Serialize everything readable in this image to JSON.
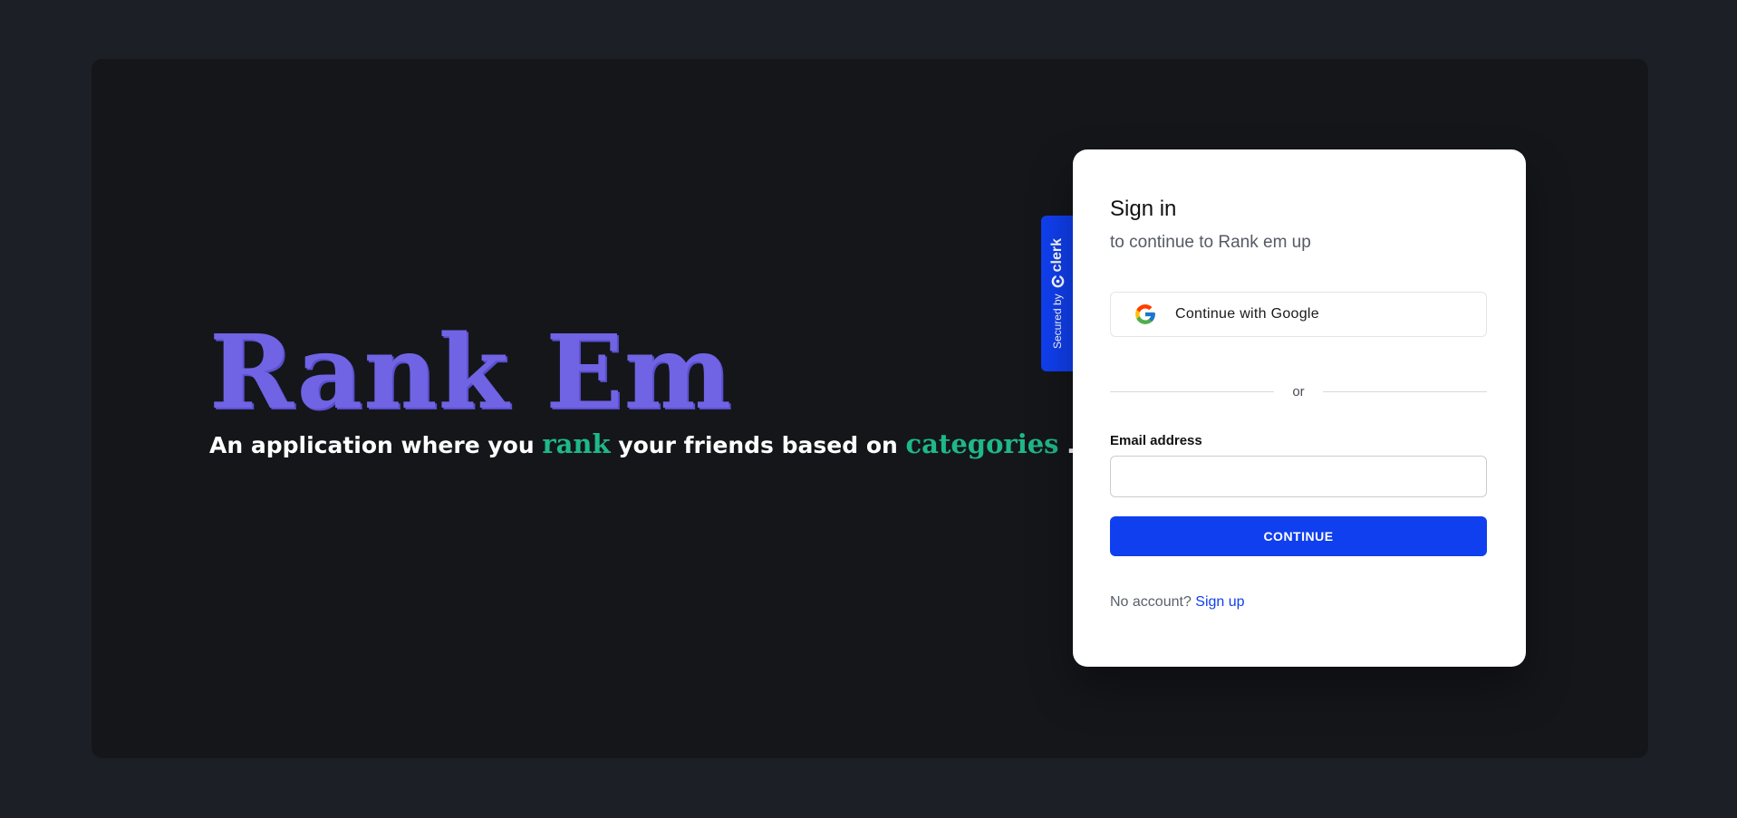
{
  "hero": {
    "title": "Rank Em",
    "tagline_part1": "An application where you ",
    "tagline_accent1": "rank",
    "tagline_part2": " your friends based on ",
    "tagline_accent2": "categories",
    "tagline_part3": " ."
  },
  "clerk_badge": {
    "secured_text": "Secured by",
    "brand": "clerk"
  },
  "signin": {
    "title": "Sign in",
    "subtitle": "to continue to Rank em up",
    "google_label": "Continue with Google",
    "divider_text": "or",
    "email_label": "Email address",
    "email_value": "",
    "continue_label": "CONTINUE",
    "no_account_text": "No account?",
    "signup_link": "Sign up"
  },
  "colors": {
    "page_background": "#1d1f27",
    "panel_background": "#15161a",
    "hero_title": "#7064e4",
    "accent_green": "#1fb889",
    "clerk_blue": "#103fef"
  },
  "icons": {
    "google": "google-g-icon",
    "clerk": "clerk-logo-icon"
  }
}
